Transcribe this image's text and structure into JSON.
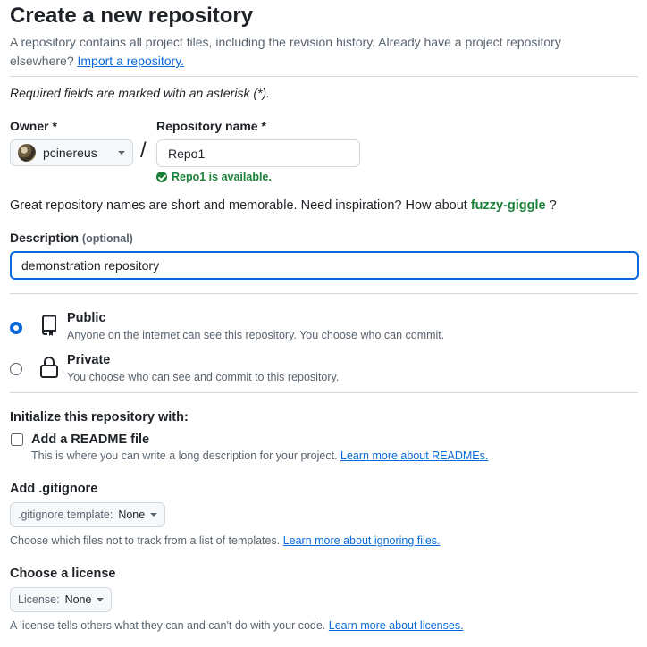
{
  "page": {
    "title": "Create a new repository",
    "intro_text": "A repository contains all project files, including the revision history. Already have a project repository elsewhere?",
    "import_link": "Import a repository.",
    "required_note": "Required fields are marked with an asterisk (*)."
  },
  "owner": {
    "label": "Owner *",
    "value": "pcinereus"
  },
  "separator": "/",
  "repo_name": {
    "label": "Repository name *",
    "value": "Repo1",
    "availability": "Repo1 is available."
  },
  "suggestion": {
    "text": "Great repository names are short and memorable. Need inspiration? How about",
    "name": "fuzzy-giggle",
    "end": "?"
  },
  "description": {
    "label": "Description",
    "optional": "(optional)",
    "value": "demonstration repository"
  },
  "visibility": {
    "options": [
      {
        "title": "Public",
        "subtitle": "Anyone on the internet can see this repository. You choose who can commit.",
        "selected": true,
        "icon": "repo-icon"
      },
      {
        "title": "Private",
        "subtitle": "You choose who can see and commit to this repository.",
        "selected": false,
        "icon": "lock-icon"
      }
    ]
  },
  "initialize": {
    "title": "Initialize this repository with:",
    "readme": {
      "label": "Add a README file",
      "description": "This is where you can write a long description for your project.",
      "link": "Learn more about READMEs.",
      "checked": false
    }
  },
  "gitignore": {
    "title": "Add .gitignore",
    "button_label": ".gitignore template:",
    "button_value": "None",
    "hint": "Choose which files not to track from a list of templates.",
    "link": "Learn more about ignoring files."
  },
  "license": {
    "title": "Choose a license",
    "button_label": "License:",
    "button_value": "None",
    "hint": "A license tells others what they can and can't do with your code.",
    "link": "Learn more about licenses."
  },
  "colors": {
    "accent": "#0969da",
    "success": "#1a7f37",
    "muted": "#59636e",
    "border": "#d1d9e0"
  }
}
